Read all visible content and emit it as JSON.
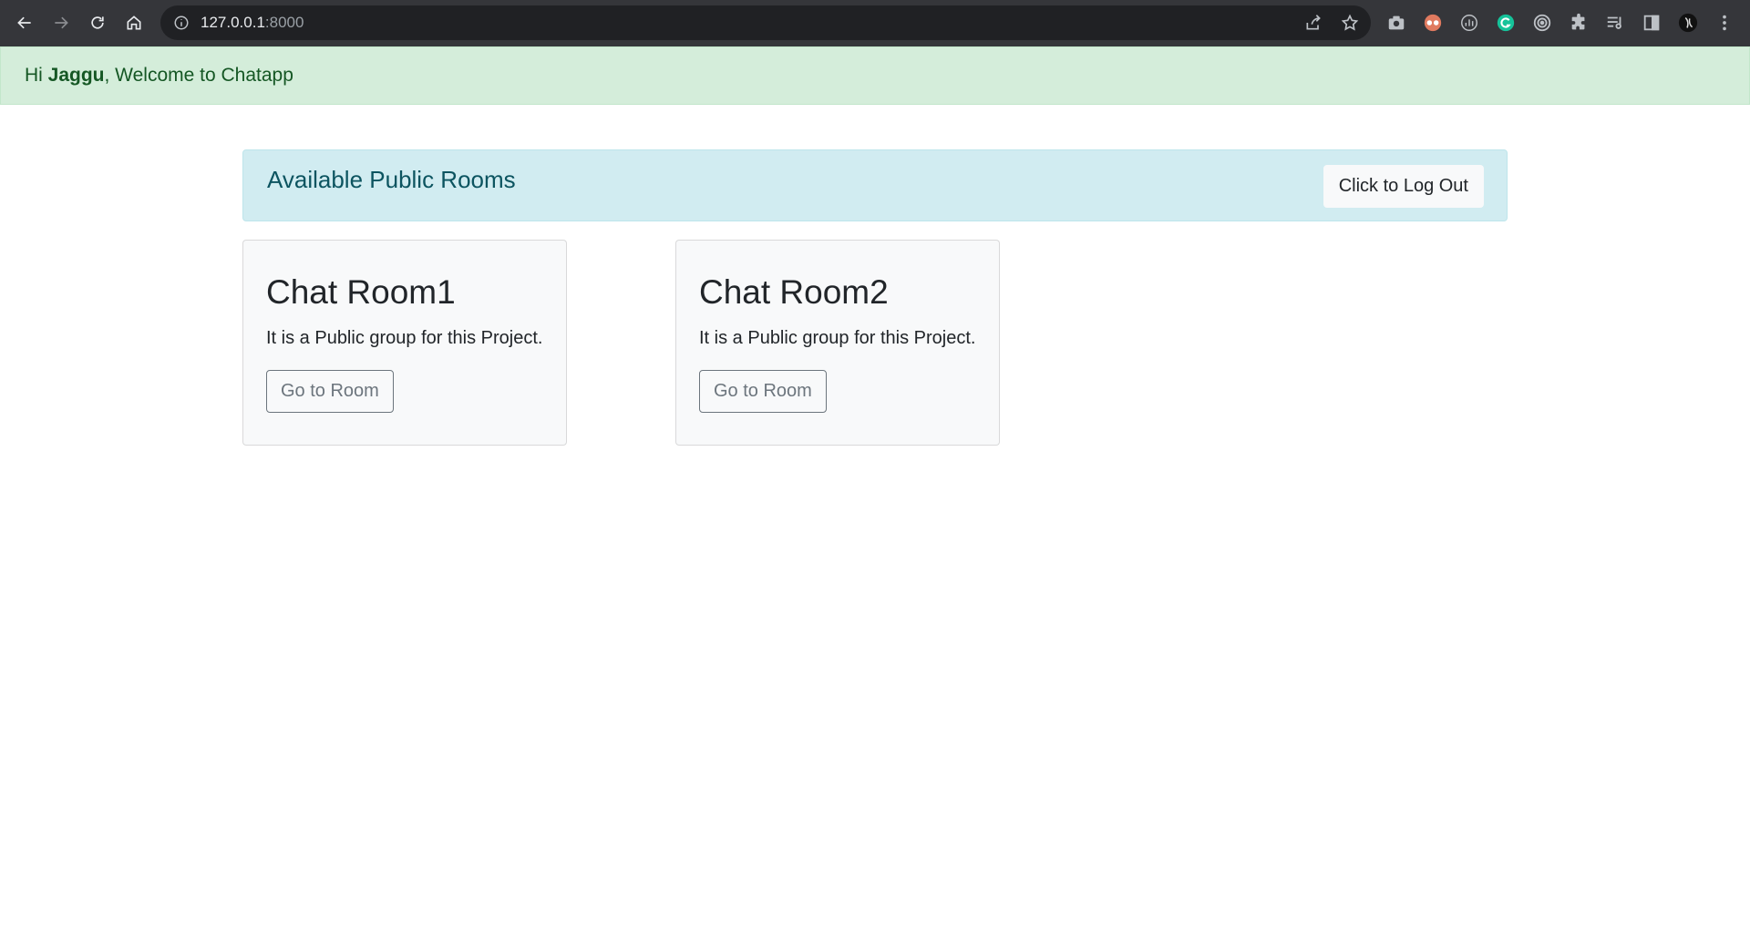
{
  "browser": {
    "url_host": "127.0.0.1",
    "url_port": ":8000",
    "icons": [
      "back-icon",
      "forward-icon",
      "reload-icon",
      "home-icon",
      "site-info-icon",
      "share-icon",
      "bookmark-star-icon",
      "camera-extension-icon",
      "glasses-extension-icon",
      "meter-extension-icon",
      "grammarly-extension-icon",
      "target-extension-icon",
      "extensions-puzzle-icon",
      "media-control-icon",
      "side-panel-icon",
      "profile-avatar",
      "menu-dots-icon"
    ]
  },
  "welcome": {
    "greeting": "Hi ",
    "username": "Jaggu",
    "message": ", Welcome to Chatapp"
  },
  "rooms_header": {
    "title": "Available Public Rooms",
    "logout_label": "Click to Log Out"
  },
  "rooms": [
    {
      "title": "Chat Room1",
      "description": "It is a Public group for this Project.",
      "button_label": "Go to Room"
    },
    {
      "title": "Chat Room2",
      "description": "It is a Public group for this Project.",
      "button_label": "Go to Room"
    }
  ],
  "colors": {
    "success_bg": "#d4edda",
    "success_text": "#155724",
    "info_bg": "#d1ecf1",
    "info_text": "#0c5460",
    "card_bg": "#f8f9fa",
    "secondary": "#6c757d"
  }
}
